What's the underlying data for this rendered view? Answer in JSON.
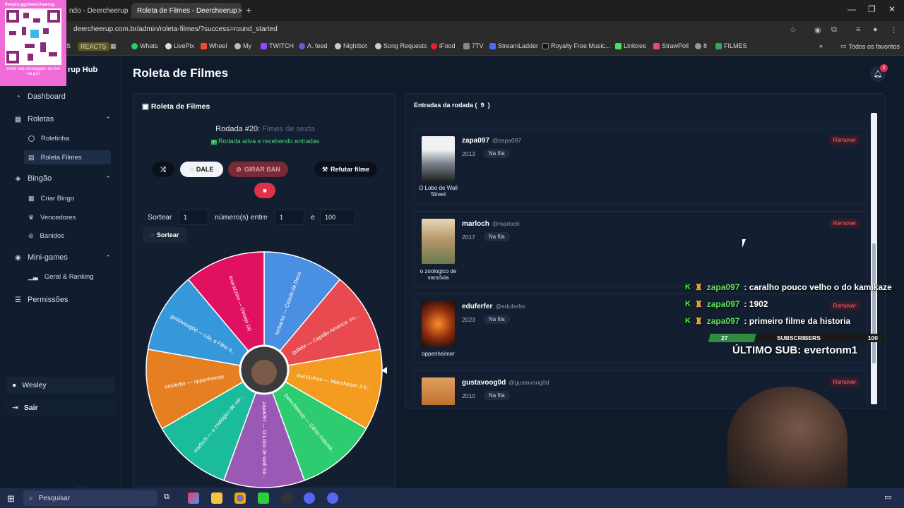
{
  "browser": {
    "tab1_title": "ndo - Deercheerup",
    "tab2_title": "Roleta de Filmes - Deercheerup",
    "url": "deercheerup.com.br/admin/roleta-filmes/?success=round_started",
    "bookmarks": [
      "AS",
      "REACTS",
      "Whats",
      "LivePix",
      "Wheel",
      "My",
      "TWITCH",
      "A. feed",
      "Nightbot",
      "Song Requests",
      "iFood",
      "7TV",
      "StreamLadder",
      "Royalty Free Music...",
      "Linktree",
      "StrawPoll",
      "8",
      "FILMES"
    ],
    "all_bookmarks": "Todos os favoritos"
  },
  "overlay": {
    "qr_caption": "livepix.gg/deercheerup",
    "qr_footer": "envie sua mensagem na live via pix!"
  },
  "sidebar": {
    "brand": "rup Hub",
    "dashboard": "Dashboard",
    "roletas": "Roletas",
    "roletinha": "Roletinha",
    "roleta_filmes": "Roleta Filmes",
    "bingao": "Bingão",
    "criar_bingo": "Criar Bingo",
    "vencedores": "Vencedores",
    "banidos": "Banidos",
    "minigames": "Mini-games",
    "geral_ranking": "Geral & Ranking",
    "permissoes": "Permissões",
    "user": "Wesley",
    "sair": "Sair"
  },
  "header": {
    "title": "Roleta de Filmes",
    "notifications": "2"
  },
  "roulette": {
    "panel_title": "Roleta de Filmes",
    "round_label": "Rodada #20:",
    "round_name": "Fimes de sexta",
    "status": "Rodada ativa e recebendo entradas",
    "btn_dale": "DALE",
    "btn_girar_ban": "GIRAR BAN",
    "btn_refutar": "Refutar filme",
    "sortear_label": "Sortear",
    "sortear_qty": "1",
    "numeros_entre": "número(s) entre",
    "min": "1",
    "e": "e",
    "max": "100",
    "btn_sortear": "Sortear",
    "segments": [
      {
        "label": "lvnbackz — Cidade de Deus",
        "color": "#4a90e2"
      },
      {
        "label": "gullebr — Capitão America: so...",
        "color": "#e84a4f"
      },
      {
        "label": "marc1nhoo — Manchester à b...",
        "color": "#f39c1f"
      },
      {
        "label": "Deercheerup — Gênio Indomá...",
        "color": "#2ecc71"
      },
      {
        "label": "zapa097 — O Lobo de Wall Str...",
        "color": "#9b59b6"
      },
      {
        "label": "marloch — o zoológico de var...",
        "color": "#1abc9c"
      },
      {
        "label": "eduferfer — oppenheimer",
        "color": "#e67e22"
      },
      {
        "label": "gustavoog0d — Lila, o Filho d...",
        "color": "#3498db"
      },
      {
        "label": "lmarazzinn — Desejo (a)",
        "color": "#e0115f"
      }
    ]
  },
  "entries": {
    "title": "Entradas da rodada (",
    "count": "9",
    "close": ")",
    "remove_label": "Remover",
    "items": [
      {
        "name": "zapa097",
        "handle": "@zapa097",
        "year": "2013",
        "status": "Na fila",
        "movie": "O Lobo de Wall Street"
      },
      {
        "name": "marloch",
        "handle": "@marloch",
        "year": "2017",
        "status": "Na fila",
        "movie": "o zoologico de varsóvia"
      },
      {
        "name": "eduferfer",
        "handle": "@eduferfer",
        "year": "2023",
        "status": "Na fila",
        "movie": "oppenheimer"
      },
      {
        "name": "gustavoog0d",
        "handle": "@gustavoog0d",
        "year": "2010",
        "status": "Na fila",
        "movie": ""
      }
    ]
  },
  "stream_overlay": {
    "chat": [
      {
        "user": "zapa097",
        "msg": ": caralho pouco velho o do kamikaze"
      },
      {
        "user": "zapa097",
        "msg": ": 1902"
      },
      {
        "user": "zapa097",
        "msg": ": primeiro filme da historia"
      }
    ],
    "sub_current": "27",
    "sub_label": "SUBSCRIBERS",
    "sub_goal": "100",
    "sub_progress": 0.27,
    "last_sub": "ÚLTIMO SUB: evertonm1"
  },
  "taskbar": {
    "search": "Pesquisar"
  }
}
